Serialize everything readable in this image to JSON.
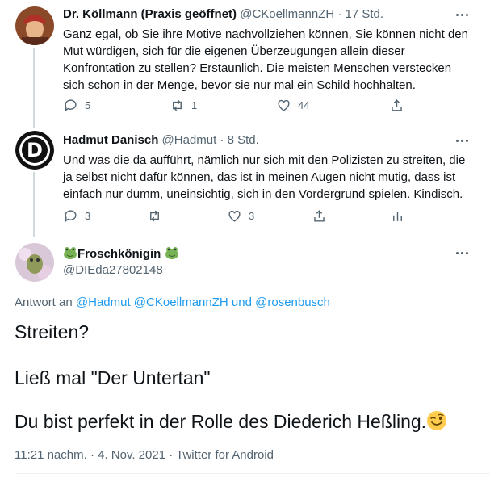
{
  "tweets": [
    {
      "name": "Dr. Köllmann (Praxis geöffnet)",
      "handle": "@CKoellmannZH",
      "time": "· 17 Std.",
      "lines": [
        "Ganz egal, ob Sie ihre Motive nachvollziehen können, Sie können nicht den",
        "Mut würdigen, sich für die eigenen Überzeugungen allein dieser",
        "Konfrontation zu stellen? Erstaunlich. Die meisten Menschen verstecken",
        "sich schon in der Menge, bevor sie nur mal ein Schild hochhalten."
      ],
      "replies": "5",
      "retweets": "1",
      "likes": "44"
    },
    {
      "name": "Hadmut Danisch",
      "handle": "@Hadmut",
      "time": "· 8 Std.",
      "avatar_letter": "D",
      "lines": [
        "Und was die da aufführt, nämlich nur sich mit den Polizisten zu streiten, die",
        "ja selbst nicht dafür können, das ist in meinen Augen nicht mutig, dass ist",
        "einfach nur dumm, uneinsichtig, sich in den Vordergrund spielen. Kindisch."
      ],
      "replies": "3",
      "retweets": "",
      "likes": "3"
    }
  ],
  "main_tweet": {
    "name": "Froschkönigin",
    "handle": "@DIEda27802148",
    "reply_prefix": "Antwort an",
    "reply_targets": "@Hadmut @CKoellmannZH",
    "reply_and": "und",
    "reply_last": "@rosenbusch_",
    "paragraphs": [
      "Streiten?",
      "Ließ mal \"Der Untertan\"",
      "Du bist perfekt in der Rolle des Diederich Heßling."
    ],
    "meta": "11:21 nachm. · 4. Nov. 2021 · Twitter for Android"
  },
  "icons": [
    "reply-icon",
    "retweet-icon",
    "like-icon",
    "share-icon",
    "analytics-icon",
    "more-icon",
    "frog-emoji",
    "wink-emoji"
  ],
  "colors": {
    "link": "#1d9bf0",
    "secondary": "#536471",
    "line": "#cfd9de"
  }
}
